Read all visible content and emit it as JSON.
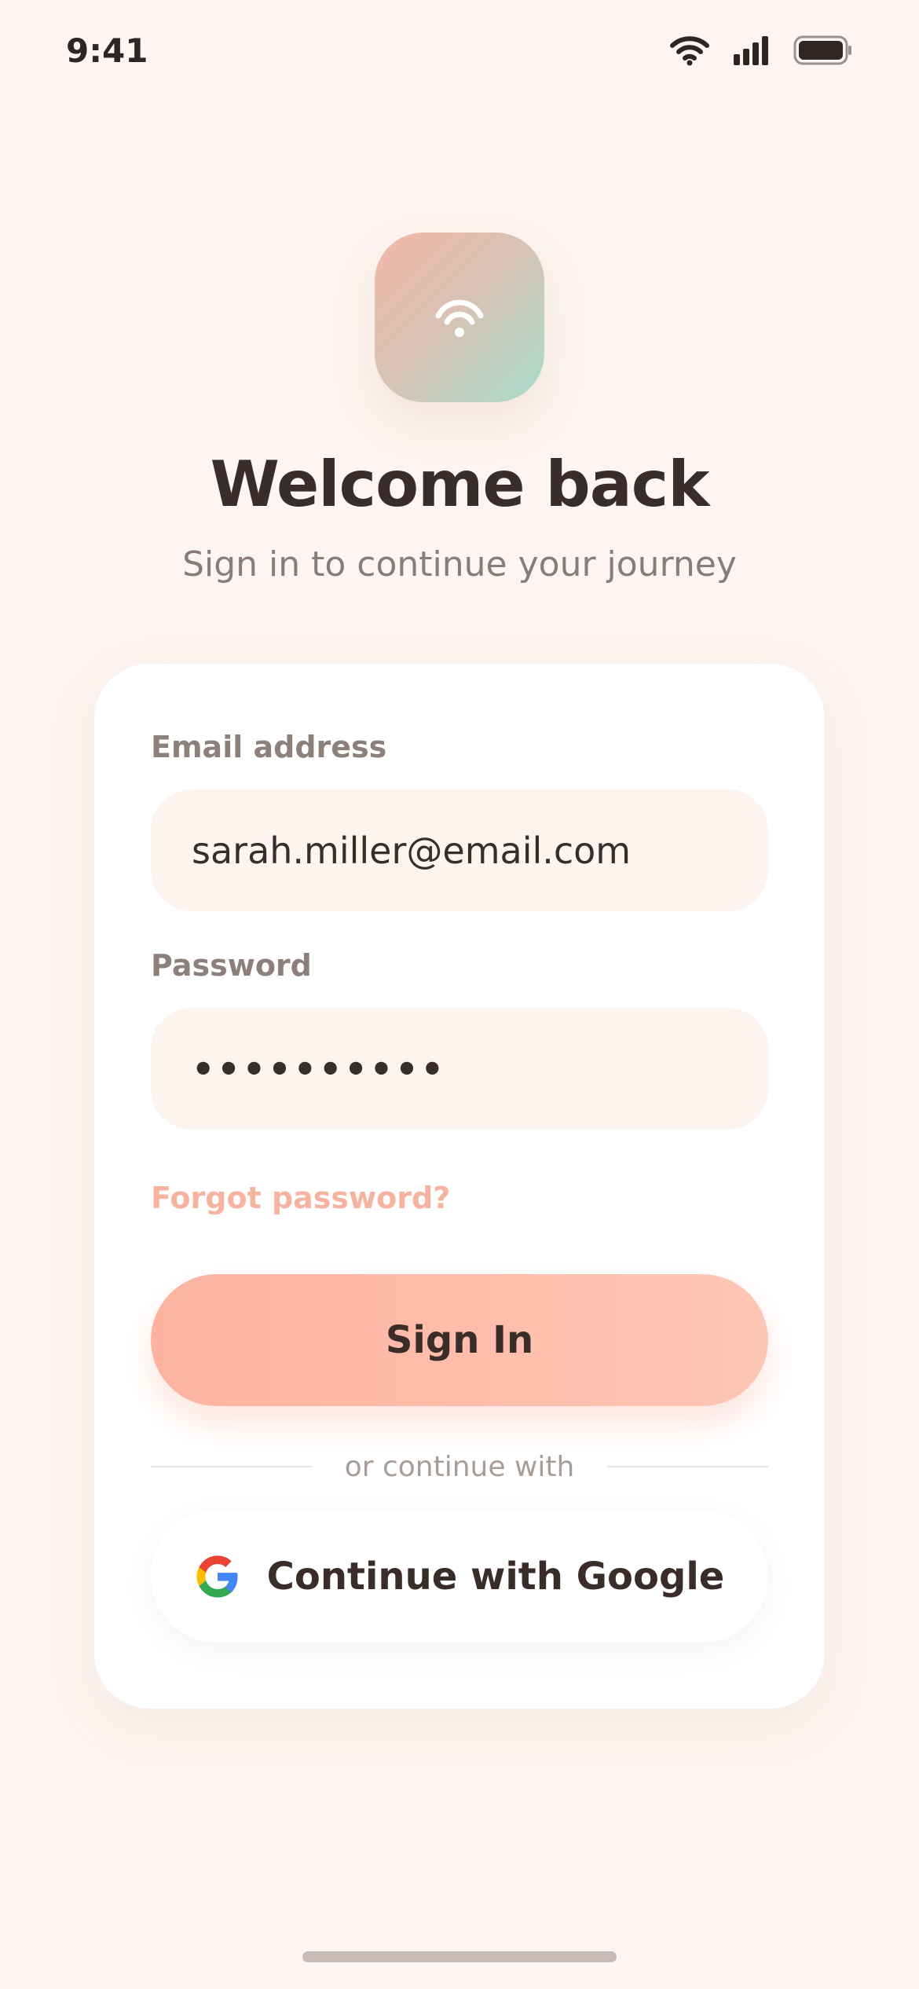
{
  "status_bar": {
    "time": "9:41",
    "icons": [
      "wifi-icon",
      "cellular-signal-icon",
      "battery-icon"
    ]
  },
  "header": {
    "logo_icon": "wifi-icon",
    "title": "Welcome back",
    "subtitle": "Sign in to continue your journey"
  },
  "form": {
    "email_label": "Email address",
    "email_value": "sarah.miller@email.com",
    "password_label": "Password",
    "password_value": "••••••••••",
    "forgot_label": "Forgot password?",
    "signin_label": "Sign In",
    "divider_label": "or continue with",
    "google_label": "Continue with Google"
  },
  "colors": {
    "background": "#fdf5f1",
    "accent": "#fdb3a0",
    "link": "#f6b3a0",
    "input_background": "#fdf3ef",
    "text_primary": "#3a2c29",
    "text_secondary": "#8a7b76"
  }
}
